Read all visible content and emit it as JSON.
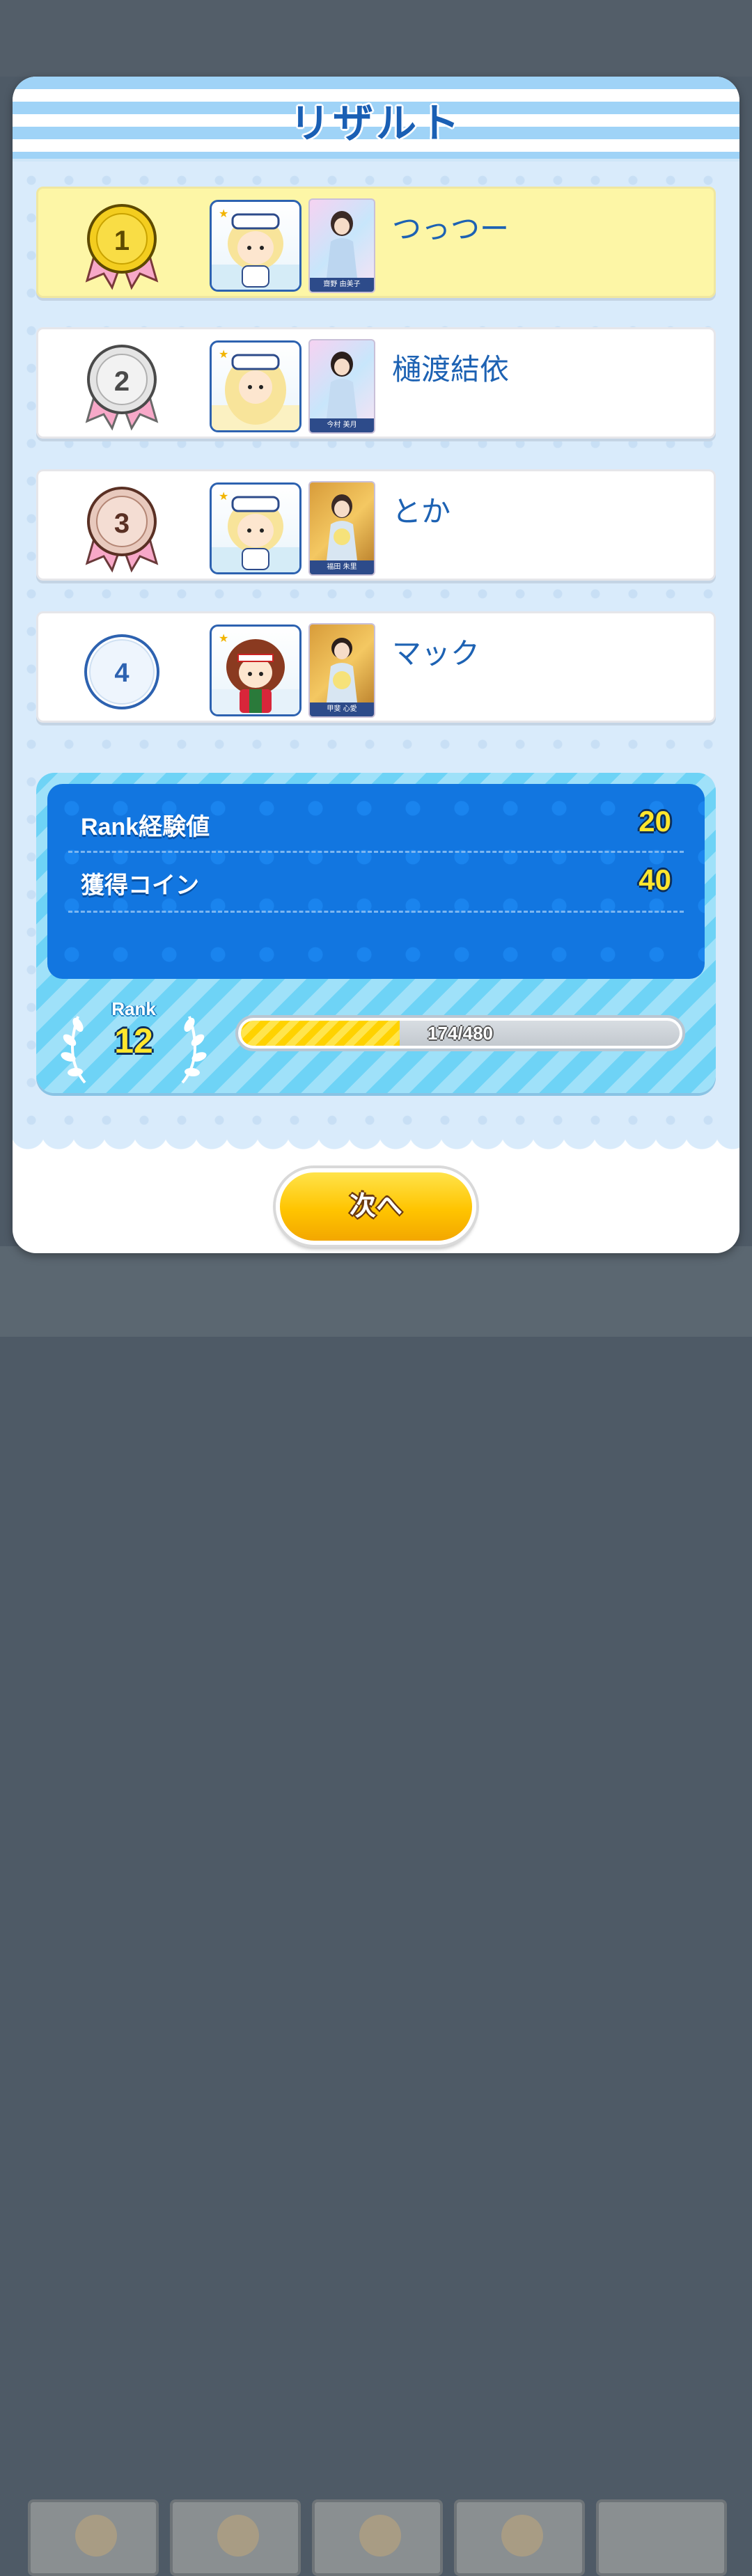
{
  "modal": {
    "title": "リザルト",
    "next_button_label": "次へ"
  },
  "results": [
    {
      "rank": "1",
      "medal": "gold-medal",
      "name": "つっつー",
      "card_caption": "齋野 由美子",
      "card_style": "purple",
      "highlight": true
    },
    {
      "rank": "2",
      "medal": "silver-medal",
      "name": "樋渡結依",
      "card_caption": "今村 美月",
      "card_style": "purple",
      "highlight": false
    },
    {
      "rank": "3",
      "medal": "bronze-medal",
      "name": "とか",
      "card_caption": "福田 朱里",
      "card_style": "gold",
      "highlight": false
    },
    {
      "rank": "4",
      "medal": "plain-badge",
      "name": "マック",
      "card_caption": "甲斐 心愛",
      "card_style": "gold",
      "highlight": false
    }
  ],
  "reward": {
    "rank_exp_label": "Rank経験値",
    "rank_exp_value": "20",
    "coin_label": "獲得コイン",
    "coin_value": "40",
    "rank_caption": "Rank",
    "rank_value": "12",
    "xp_current": 174,
    "xp_max": 480,
    "xp_text": "174/480"
  },
  "colors": {
    "accent_blue": "#1d62b3",
    "panel_blue": "#1276e0",
    "gold": "#ffe62d",
    "button_yellow": "#ffc400"
  }
}
